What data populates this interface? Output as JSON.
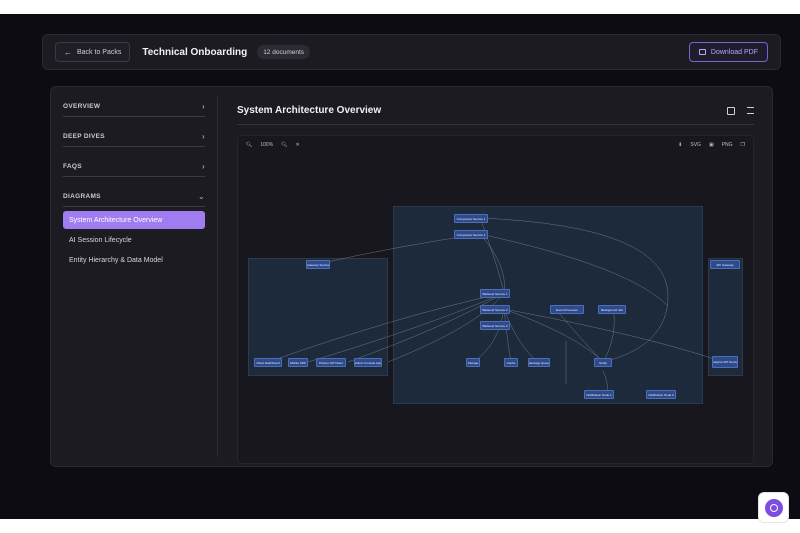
{
  "header": {
    "back_label": "Back to Packs",
    "title": "Technical Onboarding",
    "doc_count": "12 documents",
    "download_label": "Download PDF"
  },
  "sidebar": {
    "sections": [
      {
        "label": "OVERVIEW",
        "chevron": "›"
      },
      {
        "label": "DEEP DIVES",
        "chevron": "›"
      },
      {
        "label": "FAQS",
        "chevron": "›"
      },
      {
        "label": "DIAGRAMS",
        "chevron": "⌄"
      }
    ],
    "diagram_items": [
      {
        "label": "System Architecture Overview",
        "active": true
      },
      {
        "label": "AI Session Lifecycle",
        "active": false
      },
      {
        "label": "Entity Hierarchy & Data Model",
        "active": false
      }
    ]
  },
  "content": {
    "title": "System Architecture Overview",
    "zoom": "100%",
    "svg_label": "SVG",
    "png_label": "PNG"
  },
  "diagram": {
    "nodes": [
      "Component Service 1",
      "Component Service 2",
      "Gateway Service",
      "Backend Service 1",
      "Backend Service 2",
      "Backend Service 3",
      "Event Processor",
      "Background Job",
      "Client Dashboard",
      "Mobile SDK",
      "Partner API Client",
      "Admin Console App",
      "Storage",
      "Cache",
      "Message Queue",
      "Notify",
      "Notification Node 1",
      "Notification Node 2",
      "API Gateway",
      "Analytics API Service"
    ]
  },
  "colors": {
    "accent": "#9f7cf0",
    "background": "#0d0c12",
    "panel": "#1c1b22",
    "node": "#2e4a8a"
  },
  "icons": {
    "back": "arrow-left-icon",
    "download": "pdf-icon",
    "fab": "assistant-icon"
  }
}
